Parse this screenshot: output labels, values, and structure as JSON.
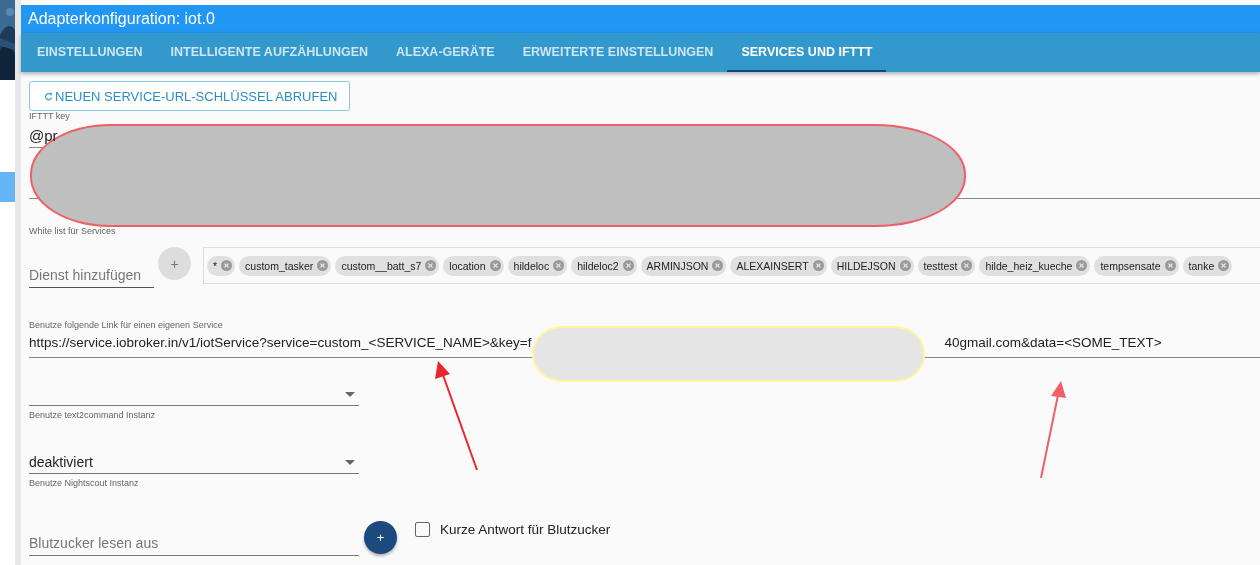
{
  "window": {
    "title": "Adapterkonfiguration: iot.0"
  },
  "tabs": [
    {
      "label": "EINSTELLUNGEN",
      "selected": false
    },
    {
      "label": "INTELLIGENTE AUFZÄHLUNGEN",
      "selected": false
    },
    {
      "label": "ALEXA-GERÄTE",
      "selected": false
    },
    {
      "label": "ERWEITERTE EINSTELLUNGEN",
      "selected": false
    },
    {
      "label": "SERVICES UND IFTTT",
      "selected": true
    }
  ],
  "refresh_button": {
    "label": "NEUEN SERVICE-URL-SCHLÜSSEL ABRUFEN"
  },
  "ifttt_key": {
    "label": "IFTTT key",
    "value": "@pr"
  },
  "whitelist": {
    "label": "White list für Services",
    "placeholder": "Dienst hinzufügen",
    "add_button": "+",
    "chips": [
      "*",
      "custom_tasker",
      "custom__batt_s7",
      "location",
      "hildeloc",
      "hildeloc2",
      "ARMINJSON",
      "ALEXAINSERT",
      "HILDEJSON",
      "testtest",
      "hilde_heiz_kueche",
      "tempsensate",
      "tanke"
    ]
  },
  "custom_link": {
    "label": "Benutze folgende Link für einen eigenen Service",
    "value_start": "https://service.iobroker.in/v1/iotService?service=custom_<SERVICE_NAME>&key=f",
    "value_end": "40gmail.com&data=<SOME_TEXT>"
  },
  "text2command": {
    "helper": "Benutze text2command Instanz"
  },
  "nightscout": {
    "value": "deaktiviert",
    "helper": "Benutze Nightscout Instanz"
  },
  "bloodsugar": {
    "placeholder": "Blutzucker lesen aus",
    "add_button": "+",
    "checkbox": {
      "label": "Kurze Antwort für Blutzucker",
      "checked": false
    }
  }
}
